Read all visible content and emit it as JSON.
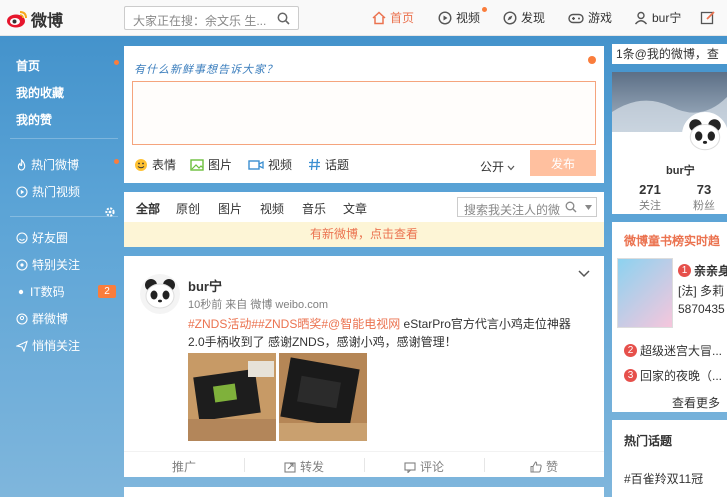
{
  "topnav": {
    "logo_text": "微博",
    "search_placeholder": "大家正在搜：余文乐 生...",
    "items": [
      {
        "label": "首页"
      },
      {
        "label": "视频"
      },
      {
        "label": "发现"
      },
      {
        "label": "游戏"
      },
      {
        "label": "bur宁"
      }
    ]
  },
  "sidebar": {
    "primary": [
      {
        "label": "首页"
      },
      {
        "label": "我的收藏"
      },
      {
        "label": "我的赞"
      }
    ],
    "hot": [
      {
        "label": "热门微博"
      },
      {
        "label": "热门视频"
      }
    ],
    "groups": [
      {
        "label": "好友圈"
      },
      {
        "label": "特别关注"
      },
      {
        "label": "IT数码",
        "badge": "2"
      },
      {
        "label": "群微博"
      },
      {
        "label": "悄悄关注"
      }
    ]
  },
  "composer": {
    "prompt": "有什么新鲜事想告诉大家？",
    "tools": [
      {
        "label": "表情"
      },
      {
        "label": "图片"
      },
      {
        "label": "视频"
      },
      {
        "label": "话题"
      }
    ],
    "visibility": "公开",
    "post_label": "发布"
  },
  "tabs": {
    "items": [
      "全部",
      "原创",
      "图片",
      "视频",
      "音乐",
      "文章"
    ],
    "search_placeholder": "搜索我关注人的微"
  },
  "new_notice": "有新微博，点击查看",
  "post": {
    "user": "bur宁",
    "meta": "10秒前 来自 微博 weibo.com",
    "tags": "#ZNDS活动##ZNDS晒奖#@智能电视网",
    "text1": " eStarPro官方代言小鸡走位神器",
    "text2": "2.0手柄收到了  感谢ZNDS，感谢小鸡，感谢管理！",
    "actions": [
      {
        "label": "推广"
      },
      {
        "label": "转发"
      },
      {
        "label": "评论"
      },
      {
        "label": "赞"
      }
    ]
  },
  "right": {
    "notice": "1条@我的微博，查",
    "profile": {
      "name": "bur宁",
      "stats": [
        {
          "num": "271",
          "label": "关注"
        },
        {
          "num": "73",
          "label": "粉丝"
        }
      ]
    },
    "books": {
      "title": "微博童书榜实时趋",
      "items": [
        {
          "rank": "1",
          "label": "亲亲身"
        },
        {
          "rank": "",
          "label": "[法] 多莉"
        },
        {
          "rank": "",
          "label": "5870435"
        },
        {
          "rank": "2",
          "label": "超级迷宫大冒..."
        },
        {
          "rank": "3",
          "label": "回家的夜晚（..."
        }
      ],
      "more": "查看更多"
    },
    "hot": {
      "title": "热门话题",
      "item": "#百雀羚双11冠"
    }
  }
}
